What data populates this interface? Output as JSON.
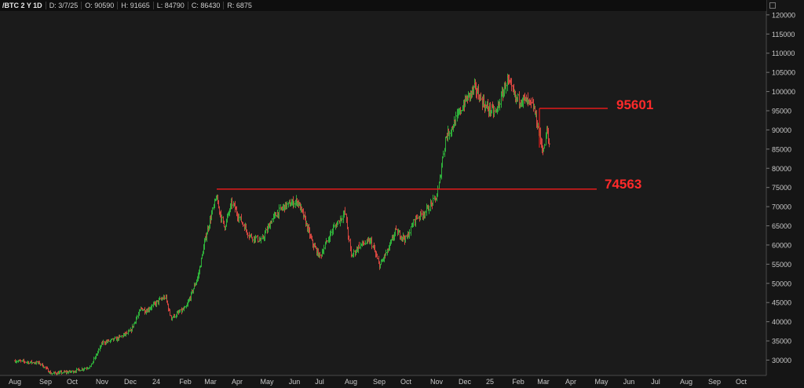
{
  "header": {
    "symbol": "/BTC 2 Y 1D",
    "date": "D: 3/7/25",
    "open": "O: 90590",
    "high": "H: 91665",
    "low": "L: 84790",
    "close": "C: 86430",
    "range": "R: 6875"
  },
  "colors": {
    "background": "#1b1b1b",
    "up": "#2eae3a",
    "down": "#d2453f",
    "level_line": "#e31b1b",
    "level_text": "#ff2a2a",
    "axis_text": "#c8c8c8"
  },
  "chart_data": {
    "type": "ohlc",
    "title": "/BTC 2 Y 1D",
    "ylim": [
      26000,
      121000
    ],
    "yticks": [
      30000,
      35000,
      40000,
      45000,
      50000,
      55000,
      60000,
      65000,
      70000,
      75000,
      80000,
      85000,
      90000,
      95000,
      100000,
      105000,
      110000,
      115000,
      120000
    ],
    "ytick_labels": [
      "30000",
      "35000",
      "40000",
      "45000",
      "50000",
      "55000",
      "60000",
      "65000",
      "70000",
      "75000",
      "80000",
      "85000",
      "90000",
      "95000",
      "100000",
      "105000",
      "110000",
      "115000",
      "120000"
    ],
    "x_labels": [
      "Aug",
      "Sep",
      "Oct",
      "Nov",
      "Dec",
      "24",
      "Feb",
      "Mar",
      "Apr",
      "May",
      "Jun",
      "Jul",
      "Aug",
      "Sep",
      "Oct",
      "Nov",
      "Dec",
      "25",
      "Feb",
      "Mar",
      "Apr",
      "May",
      "Jun",
      "Jul",
      "Aug",
      "Sep",
      "Oct"
    ],
    "price_path": [
      {
        "t": 0,
        "p": 29800
      },
      {
        "t": 0.8,
        "p": 29200
      },
      {
        "t": 1.2,
        "p": 26500
      },
      {
        "t": 2.0,
        "p": 27000
      },
      {
        "t": 2.6,
        "p": 28300
      },
      {
        "t": 3.0,
        "p": 34500
      },
      {
        "t": 3.5,
        "p": 35500
      },
      {
        "t": 4.0,
        "p": 37500
      },
      {
        "t": 4.4,
        "p": 43500
      },
      {
        "t": 4.6,
        "p": 42800
      },
      {
        "t": 5.0,
        "p": 45000
      },
      {
        "t": 5.3,
        "p": 46500
      },
      {
        "t": 5.5,
        "p": 41000
      },
      {
        "t": 6.0,
        "p": 43500
      },
      {
        "t": 6.5,
        "p": 52000
      },
      {
        "t": 6.8,
        "p": 62000
      },
      {
        "t": 7.0,
        "p": 67000
      },
      {
        "t": 7.2,
        "p": 72500
      },
      {
        "t": 7.5,
        "p": 64500
      },
      {
        "t": 7.8,
        "p": 71000
      },
      {
        "t": 8.0,
        "p": 68000
      },
      {
        "t": 8.4,
        "p": 62500
      },
      {
        "t": 8.8,
        "p": 61000
      },
      {
        "t": 9.2,
        "p": 67000
      },
      {
        "t": 9.6,
        "p": 70000
      },
      {
        "t": 10.1,
        "p": 71500
      },
      {
        "t": 10.4,
        "p": 66500
      },
      {
        "t": 10.7,
        "p": 60500
      },
      {
        "t": 11.0,
        "p": 57000
      },
      {
        "t": 11.4,
        "p": 64000
      },
      {
        "t": 11.8,
        "p": 68500
      },
      {
        "t": 12.0,
        "p": 57000
      },
      {
        "t": 12.3,
        "p": 60000
      },
      {
        "t": 12.7,
        "p": 61000
      },
      {
        "t": 13.0,
        "p": 54500
      },
      {
        "t": 13.3,
        "p": 58500
      },
      {
        "t": 13.6,
        "p": 63500
      },
      {
        "t": 14.0,
        "p": 61500
      },
      {
        "t": 14.3,
        "p": 67000
      },
      {
        "t": 14.6,
        "p": 68500
      },
      {
        "t": 15.0,
        "p": 72500
      },
      {
        "t": 15.1,
        "p": 77000
      },
      {
        "t": 15.3,
        "p": 88000
      },
      {
        "t": 15.6,
        "p": 91500
      },
      {
        "t": 16.0,
        "p": 97500
      },
      {
        "t": 16.4,
        "p": 101000
      },
      {
        "t": 16.8,
        "p": 96000
      },
      {
        "t": 17.2,
        "p": 94500
      },
      {
        "t": 17.6,
        "p": 103000
      },
      {
        "t": 17.9,
        "p": 98000
      },
      {
        "t": 18.2,
        "p": 98000
      },
      {
        "t": 18.6,
        "p": 96000
      },
      {
        "t": 18.8,
        "p": 90000
      },
      {
        "t": 19.0,
        "p": 84000
      },
      {
        "t": 19.1,
        "p": 90000
      },
      {
        "t": 19.2,
        "p": 86400
      }
    ],
    "levels": [
      {
        "label": "95601",
        "value": 95601
      },
      {
        "label": "74563",
        "value": 74563
      }
    ]
  }
}
